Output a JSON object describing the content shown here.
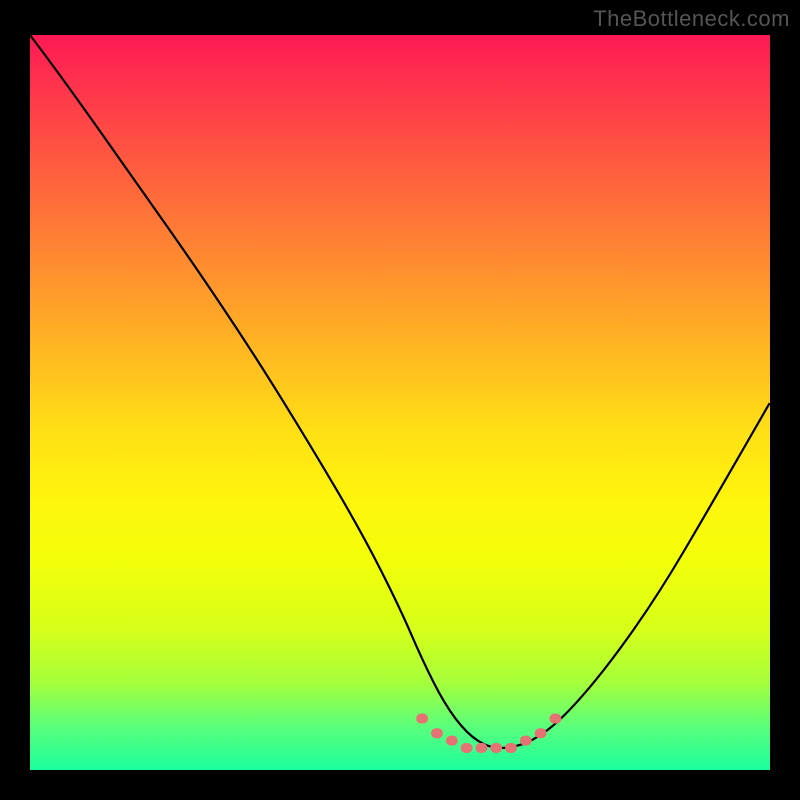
{
  "watermark": "TheBottleneck.com",
  "chart_data": {
    "type": "line",
    "title": "",
    "xlabel": "",
    "ylabel": "",
    "xlim": [
      0,
      100
    ],
    "ylim": [
      0,
      100
    ],
    "series": [
      {
        "name": "curve",
        "color": "#000000",
        "x": [
          0,
          3,
          8,
          15,
          22,
          30,
          38,
          45,
          50,
          53,
          56,
          59,
          62,
          65,
          68,
          72,
          78,
          85,
          92,
          100
        ],
        "y": [
          100,
          96,
          89,
          79,
          69,
          57,
          44,
          32,
          22,
          15,
          9,
          5,
          3,
          3,
          4,
          7,
          14,
          24,
          36,
          50
        ]
      },
      {
        "name": "bottom-marker",
        "color": "#e57373",
        "x": [
          53,
          55,
          57,
          59,
          61,
          63,
          65,
          67,
          69,
          71
        ],
        "y": [
          7,
          5,
          4,
          3,
          3,
          3,
          3,
          4,
          5,
          7
        ]
      }
    ],
    "gradient_stops": [
      {
        "pos": 0.0,
        "color": "#ff1a55"
      },
      {
        "pos": 0.09,
        "color": "#ff3b4a"
      },
      {
        "pos": 0.18,
        "color": "#ff5c3f"
      },
      {
        "pos": 0.27,
        "color": "#ff7d35"
      },
      {
        "pos": 0.36,
        "color": "#ff9e2a"
      },
      {
        "pos": 0.45,
        "color": "#ffbf1f"
      },
      {
        "pos": 0.54,
        "color": "#ffe015"
      },
      {
        "pos": 0.63,
        "color": "#fff50c"
      },
      {
        "pos": 0.72,
        "color": "#f2ff0a"
      },
      {
        "pos": 0.81,
        "color": "#d6ff1a"
      },
      {
        "pos": 0.88,
        "color": "#a6ff3a"
      },
      {
        "pos": 0.94,
        "color": "#5cff7a"
      },
      {
        "pos": 1.0,
        "color": "#1aff9e"
      }
    ]
  }
}
